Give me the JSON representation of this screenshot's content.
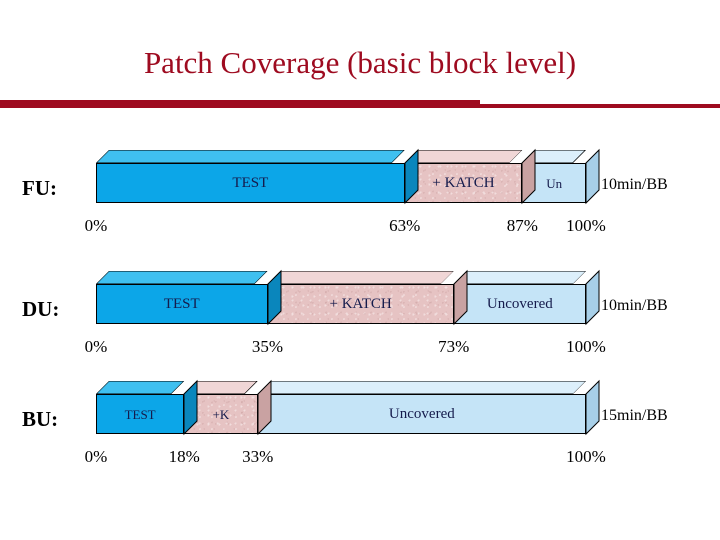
{
  "slide": {
    "title": "Patch Coverage (basic block level)",
    "title_color": "#9E0B20",
    "accent_color": "#9E0B20",
    "background": "#ffffff"
  },
  "colors": {
    "test": "#0CA6E8",
    "katch": "#E6C3C3",
    "uncovered": "#C5E4F7",
    "label_text": "#151B4C",
    "tick_text": "#000000"
  },
  "rows": [
    {
      "id": "fu",
      "label": "FU:",
      "time": "10min/BB",
      "segments": [
        {
          "label": "TEST",
          "start": 0,
          "end": 63,
          "color": "test"
        },
        {
          "label": "+ KATCH",
          "start": 63,
          "end": 87,
          "color": "katch"
        },
        {
          "label": "Un",
          "start": 87,
          "end": 100,
          "color": "uncovered"
        }
      ],
      "ticks": [
        {
          "text": "0%",
          "value": 0
        },
        {
          "text": "63%",
          "value": 63
        },
        {
          "text": "87%",
          "value": 87
        },
        {
          "text": "100%",
          "value": 100
        }
      ]
    },
    {
      "id": "du",
      "label": "DU:",
      "time": "10min/BB",
      "segments": [
        {
          "label": "TEST",
          "start": 0,
          "end": 35,
          "color": "test"
        },
        {
          "label": "+ KATCH",
          "start": 35,
          "end": 73,
          "color": "katch"
        },
        {
          "label": "Uncovered",
          "start": 73,
          "end": 100,
          "color": "uncovered"
        }
      ],
      "ticks": [
        {
          "text": "0%",
          "value": 0
        },
        {
          "text": "35%",
          "value": 35
        },
        {
          "text": "73%",
          "value": 73
        },
        {
          "text": "100%",
          "value": 100
        }
      ]
    },
    {
      "id": "bu",
      "label": "BU:",
      "time": "15min/BB",
      "segments": [
        {
          "label": "TEST",
          "start": 0,
          "end": 18,
          "color": "test"
        },
        {
          "label": "+K",
          "start": 18,
          "end": 33,
          "color": "katch"
        },
        {
          "label": "Uncovered",
          "start": 33,
          "end": 100,
          "color": "uncovered"
        }
      ],
      "ticks": [
        {
          "text": "0%",
          "value": 0
        },
        {
          "text": "18%",
          "value": 18
        },
        {
          "text": "33%",
          "value": 33
        },
        {
          "text": "100%",
          "value": 100
        }
      ]
    }
  ],
  "chart_data": {
    "type": "bar",
    "title": "Patch Coverage (basic block level)",
    "orientation": "horizontal-stacked",
    "xlabel": "",
    "ylabel": "",
    "xlim": [
      0,
      100
    ],
    "unit": "percent",
    "grid": false,
    "legend": "inline-segment-labels",
    "categories": [
      "FU",
      "DU",
      "BU"
    ],
    "series": [
      {
        "name": "TEST",
        "values": [
          63,
          35,
          18
        ]
      },
      {
        "name": "+ KATCH",
        "values": [
          24,
          38,
          15
        ]
      },
      {
        "name": "Uncovered",
        "values": [
          13,
          27,
          67
        ]
      }
    ],
    "cumulative_boundaries": {
      "FU": [
        0,
        63,
        87,
        100
      ],
      "DU": [
        0,
        35,
        73,
        100
      ],
      "BU": [
        0,
        18,
        33,
        100
      ]
    },
    "annotations": [
      {
        "category": "FU",
        "text": "10min/BB"
      },
      {
        "category": "DU",
        "text": "10min/BB"
      },
      {
        "category": "BU",
        "text": "15min/BB"
      }
    ]
  }
}
